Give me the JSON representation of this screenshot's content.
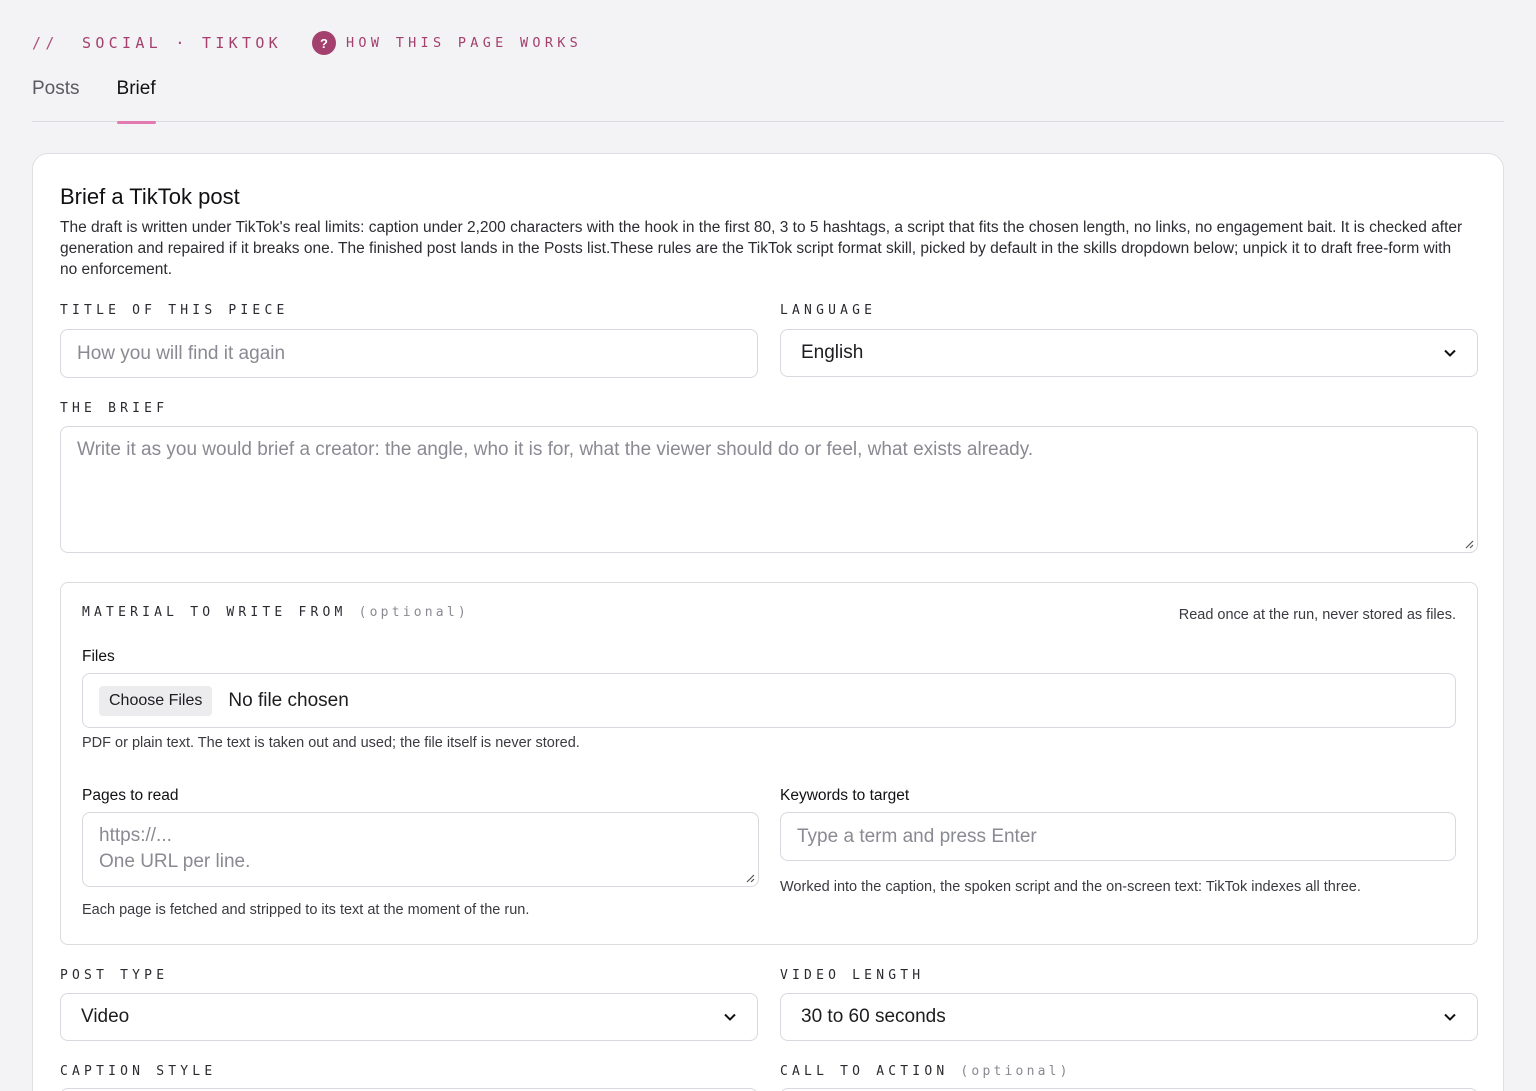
{
  "header": {
    "crumb_slashes": "//",
    "crumb": "SOCIAL · TIKTOK",
    "help_badge": "?",
    "help_link": "HOW THIS PAGE WORKS"
  },
  "tabs": [
    {
      "label": "Posts",
      "active": false
    },
    {
      "label": "Brief",
      "active": true
    }
  ],
  "card": {
    "title": "Brief a TikTok post",
    "description": "The draft is written under TikTok's real limits: caption under 2,200 characters with the hook in the first 80, 3 to 5 hashtags, a script that fits the chosen length, no links, no engagement bait. It is checked after generation and repaired if it breaks one. The finished post lands in the Posts list.These rules are the TikTok script format skill, picked by default in the skills dropdown below; unpick it to draft free-form with no enforcement."
  },
  "form": {
    "title_label": "TITLE OF THIS PIECE",
    "title_placeholder": "How you will find it again",
    "language_label": "LANGUAGE",
    "language_value": "English",
    "brief_label": "THE BRIEF",
    "brief_placeholder": "Write it as you would brief a creator: the angle, who it is for, what the viewer should do or feel, what exists already.",
    "post_type_label": "POST TYPE",
    "post_type_value": "Video",
    "video_length_label": "VIDEO LENGTH",
    "video_length_value": "30 to 60 seconds",
    "caption_style_label": "CAPTION STYLE",
    "cta_label": "CALL TO ACTION",
    "cta_optional": "(optional)"
  },
  "material": {
    "label": "MATERIAL TO WRITE FROM",
    "optional": "(optional)",
    "note": "Read once at the run, never stored as files.",
    "files_label": "Files",
    "choose_files": "Choose Files",
    "no_file": "No file chosen",
    "files_help": "PDF or plain text. The text is taken out and used; the file itself is never stored.",
    "pages_label": "Pages to read",
    "pages_placeholder_1": "https://...",
    "pages_placeholder_2": "One URL per line.",
    "pages_help": "Each page is fetched and stripped to its text at the moment of the run.",
    "keywords_label": "Keywords to target",
    "keywords_placeholder": "Type a term and press Enter",
    "keywords_help": "Worked into the caption, the spoken script and the on-screen text: TikTok indexes all three."
  },
  "colors": {
    "accent": "#a3406e",
    "tab_underline": "#e27ab2",
    "background": "#f3f3f5"
  }
}
